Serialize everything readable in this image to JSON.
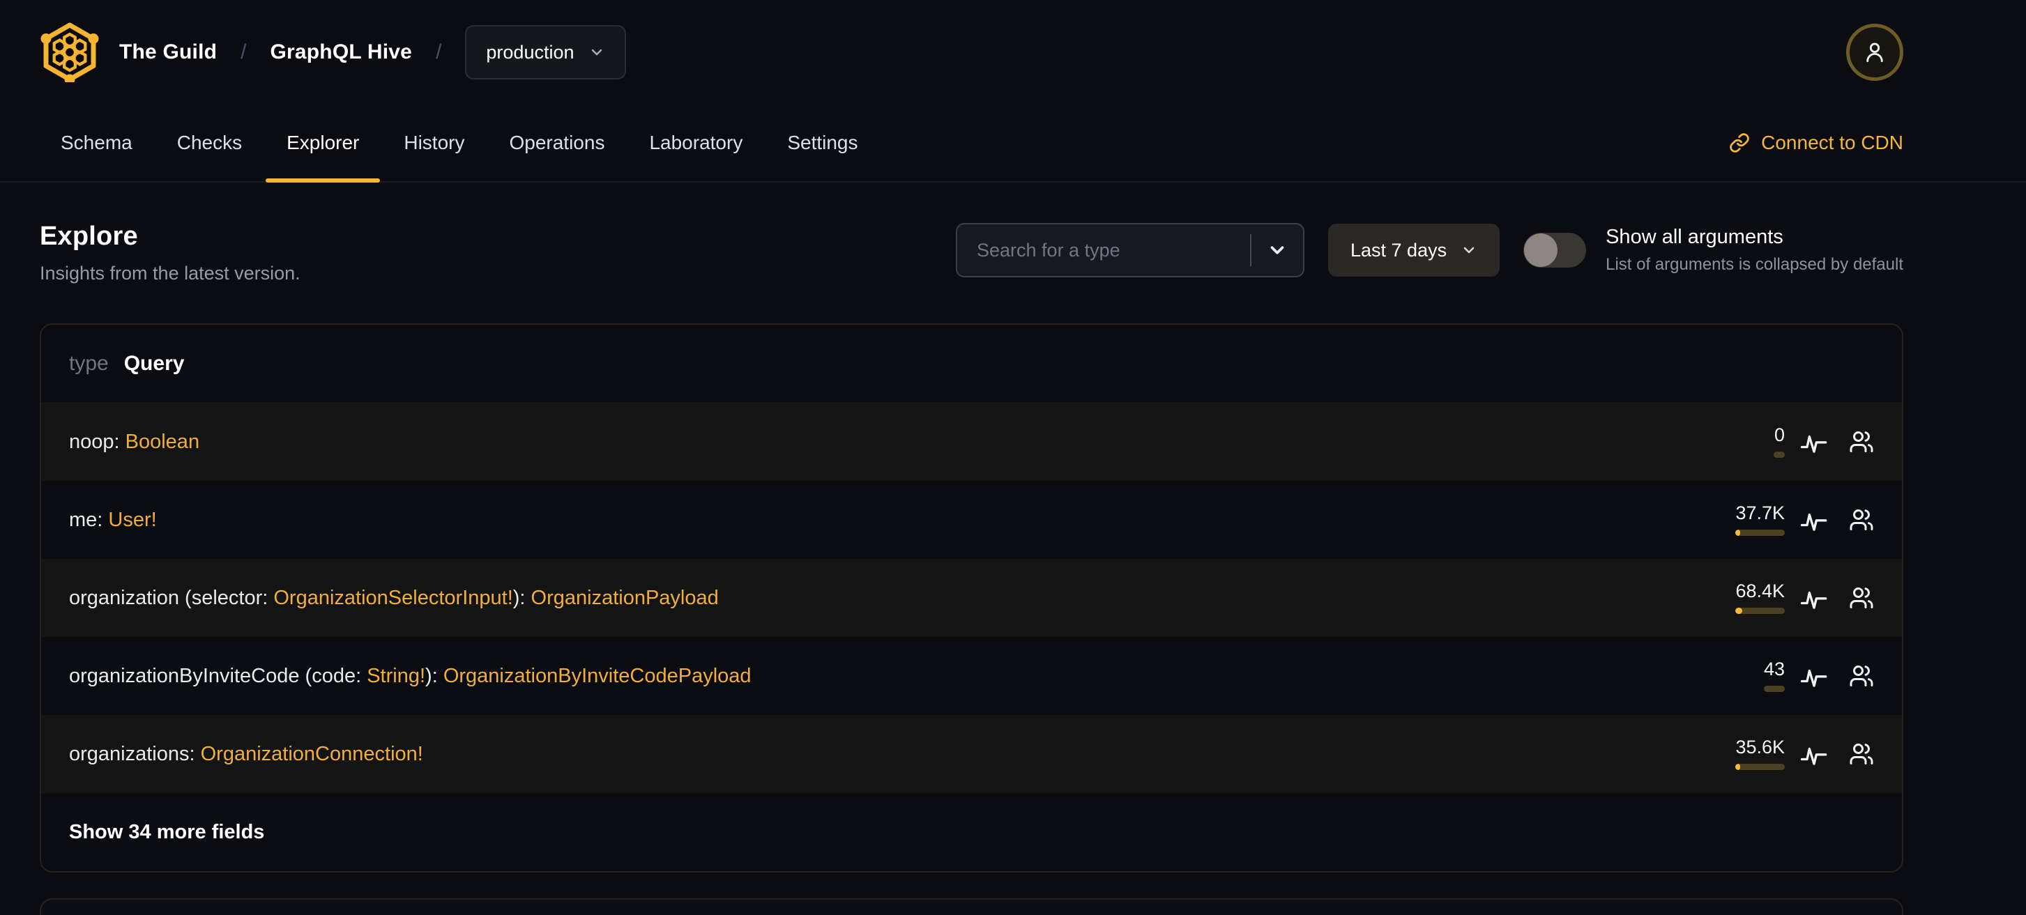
{
  "header": {
    "breadcrumb": {
      "org": "The Guild",
      "project": "GraphQL Hive",
      "separator": "/"
    },
    "target_select": {
      "value": "production"
    }
  },
  "nav": {
    "tabs": [
      {
        "label": "Schema",
        "active": false
      },
      {
        "label": "Checks",
        "active": false
      },
      {
        "label": "Explorer",
        "active": true
      },
      {
        "label": "History",
        "active": false
      },
      {
        "label": "Operations",
        "active": false
      },
      {
        "label": "Laboratory",
        "active": false
      },
      {
        "label": "Settings",
        "active": false
      }
    ],
    "cdn_link_label": "Connect to CDN"
  },
  "page": {
    "title": "Explore",
    "subtitle": "Insights from the latest version."
  },
  "controls": {
    "search": {
      "placeholder": "Search for a type"
    },
    "period": {
      "label": "Last 7 days"
    },
    "arguments_toggle": {
      "label": "Show all arguments",
      "description": "List of arguments is collapsed by default",
      "state": "off"
    }
  },
  "type_card": {
    "kind": "type",
    "name": "Query",
    "fields": [
      {
        "signature": [
          {
            "text": "noop: ",
            "kind": "plain"
          },
          {
            "text": "Boolean",
            "kind": "type"
          }
        ],
        "requests": "0",
        "usage_pct": 0
      },
      {
        "signature": [
          {
            "text": "me: ",
            "kind": "plain"
          },
          {
            "text": "User!",
            "kind": "type"
          }
        ],
        "requests": "37.7K",
        "usage_pct": 9
      },
      {
        "signature": [
          {
            "text": "organization (selector: ",
            "kind": "plain"
          },
          {
            "text": "OrganizationSelectorInput!",
            "kind": "type"
          },
          {
            "text": "): ",
            "kind": "plain"
          },
          {
            "text": "OrganizationPayload",
            "kind": "type"
          }
        ],
        "requests": "68.4K",
        "usage_pct": 14
      },
      {
        "signature": [
          {
            "text": "organizationByInviteCode (code: ",
            "kind": "plain"
          },
          {
            "text": "String!",
            "kind": "type"
          },
          {
            "text": "): ",
            "kind": "plain"
          },
          {
            "text": "OrganizationByInviteCodePayload",
            "kind": "type"
          }
        ],
        "requests": "43",
        "usage_pct": 0
      },
      {
        "signature": [
          {
            "text": "organizations: ",
            "kind": "plain"
          },
          {
            "text": "OrganizationConnection!",
            "kind": "type"
          }
        ],
        "requests": "35.6K",
        "usage_pct": 9
      }
    ],
    "show_more_label": "Show 34 more fields"
  },
  "colors": {
    "accent": "#f3b63f",
    "type_color": "#f0ae3f",
    "bar_track": "#4a4223",
    "bar_fill": "#f6bb3f"
  }
}
